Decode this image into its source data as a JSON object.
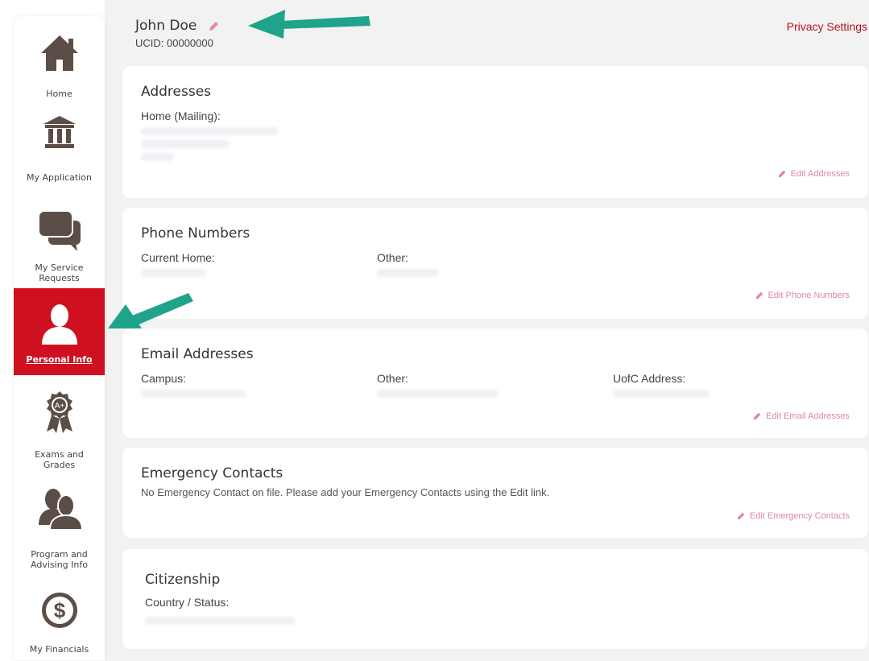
{
  "sidebar": {
    "items": [
      {
        "label": "Home",
        "icon": "home-icon"
      },
      {
        "label": "My Application",
        "icon": "institution-icon"
      },
      {
        "label": "My Service Requests",
        "icon": "chat-bubbles-icon"
      },
      {
        "label": "Personal Info",
        "icon": "person-icon",
        "active": true
      },
      {
        "label": "Exams and Grades",
        "icon": "award-ribbon-icon"
      },
      {
        "label": "Program and Advising Info",
        "icon": "people-icon"
      },
      {
        "label": "My Financials",
        "icon": "dollar-coin-icon"
      }
    ],
    "active_color": "#cf1020"
  },
  "header": {
    "name": "John Doe",
    "ucid": "UCID: 00000000",
    "privacy_link": "Privacy Settings"
  },
  "cards": {
    "addresses": {
      "title": "Addresses",
      "home_label": "Home (Mailing):",
      "edit": "Edit Addresses"
    },
    "phones": {
      "title": "Phone Numbers",
      "current_label": "Current Home:",
      "other_label": "Other:",
      "edit": "Edit Phone Numbers"
    },
    "emails": {
      "title": "Email Addresses",
      "campus_label": "Campus:",
      "other_label": "Other:",
      "uofc_label": "UofC Address:",
      "edit": "Edit Email Addresses"
    },
    "emergency": {
      "title": "Emergency Contacts",
      "message": "No Emergency Contact on file. Please add your Emergency Contacts using the Edit link.",
      "edit": "Edit Emergency Contacts"
    },
    "citizenship": {
      "title": "Citizenship",
      "country_label": "Country / Status:"
    }
  },
  "colors": {
    "brand_red": "#cf1020",
    "link_red": "#b5121b",
    "edit_pink": "#e0889a",
    "arrow_green": "#1fa38b"
  }
}
